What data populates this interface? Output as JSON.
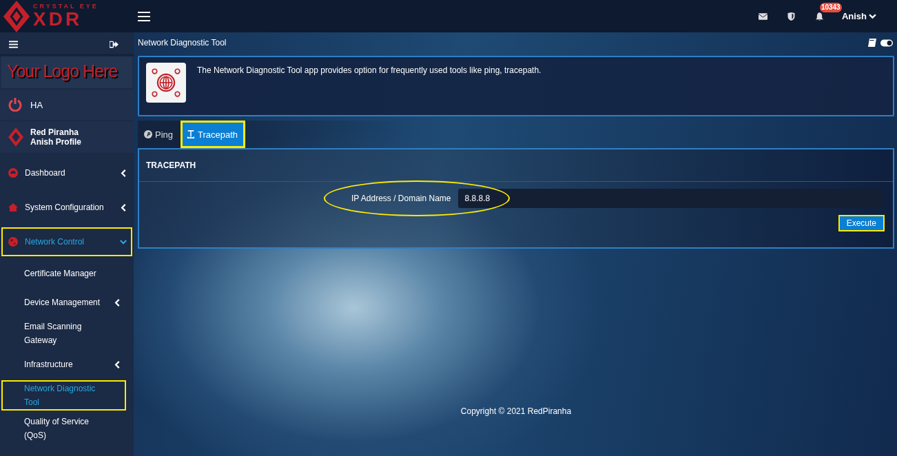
{
  "brand": {
    "tagline": "CRYSTAL EYE",
    "name": "XDR"
  },
  "header": {
    "notification_count": "10343",
    "user": "Anish"
  },
  "sidebar": {
    "logo_text": "Your Logo Here",
    "ha_label": "HA",
    "profile": {
      "name": "Red Piranha",
      "subtitle": "Anish Profile"
    },
    "items": [
      {
        "label": "Dashboard",
        "expanded": false,
        "selected": false,
        "highlighted": false
      },
      {
        "label": "System Configuration",
        "expanded": false,
        "selected": false,
        "highlighted": false
      },
      {
        "label": "Network Control",
        "expanded": true,
        "selected": true,
        "highlighted": true,
        "children": [
          {
            "label": "Certificate Manager",
            "selected": false,
            "highlighted": false
          },
          {
            "label": "Device Management",
            "expanded": false,
            "selected": false,
            "highlighted": false
          },
          {
            "label": "Email Scanning Gateway",
            "selected": false,
            "highlighted": false
          },
          {
            "label": "Infrastructure",
            "expanded": false,
            "selected": false,
            "highlighted": false
          },
          {
            "label": "Network Diagnostic Tool",
            "selected": true,
            "highlighted": true
          },
          {
            "label": "Quality of Service (QoS)",
            "selected": false,
            "highlighted": false
          }
        ]
      }
    ]
  },
  "page": {
    "title": "Network Diagnostic Tool",
    "description": "The Network Diagnostic Tool app provides option for frequently used tools like ping, tracepath.",
    "tabs": [
      {
        "label": "Ping",
        "selected": false,
        "highlighted": false
      },
      {
        "label": "Tracepath",
        "selected": true,
        "highlighted": true
      }
    ],
    "panel": {
      "title": "TRACEPATH",
      "field": {
        "label": "IP Address / Domain Name",
        "value": "8.8.8.8",
        "highlighted": true
      },
      "button": {
        "label": "Execute",
        "highlighted": true
      }
    }
  },
  "footer": {
    "copyright": "Copyright © 2021 RedPiranha"
  }
}
